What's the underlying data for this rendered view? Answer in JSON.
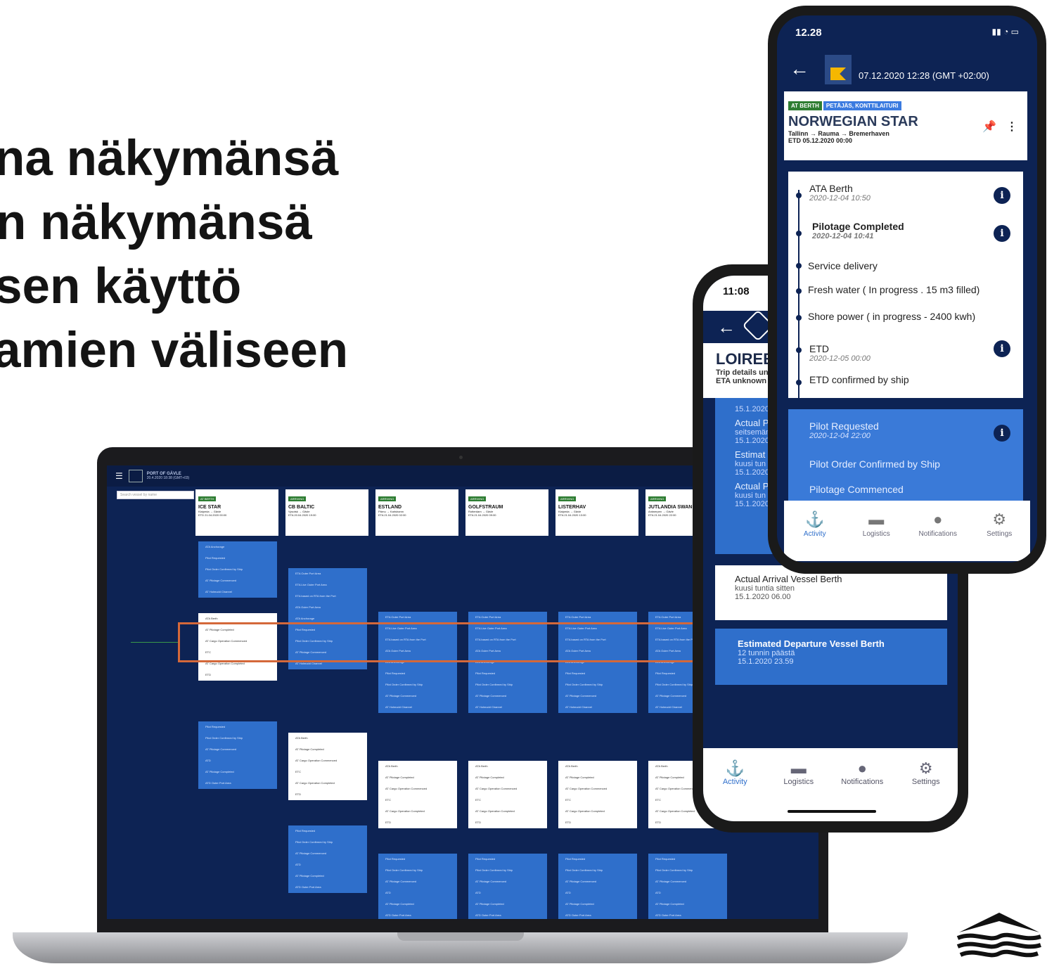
{
  "headline": {
    "line1": "na näkymänsä",
    "line2": "n näkymänsä",
    "line3": "sen käyttö",
    "line4": "amien väliseen"
  },
  "laptop": {
    "port_title": "PORT OF GÄVLE",
    "port_time": "20.4.2020 18:38 (GMT+03)",
    "search_placeholder": "Search vessel by name",
    "ships": [
      {
        "badge": "AT BERTH",
        "name": "ICE STAR",
        "route": "Klaipeda → Gävle",
        "eta": "ETD 21.04.2020 00:00"
      },
      {
        "badge": "ARRIVING",
        "name": "CB BALTIC",
        "route": "Vysotsk → Gävle",
        "eta": "ETA 20.04.2020 19:00"
      },
      {
        "badge": "ARRIVING",
        "name": "ESTLAND",
        "route": "Pärnu → Karlshamn",
        "eta": "ETA 21.04.2020 02:00"
      },
      {
        "badge": "ARRIVING",
        "name": "GOLFSTRAUM",
        "route": "Rotterdam → Gävle",
        "eta": "ETA 21.04.2020 09:00"
      },
      {
        "badge": "ARRIVING",
        "name": "LISTERHAV",
        "route": "Klaipeda → Gävle",
        "eta": "ETA 21.04.2020 13:00"
      },
      {
        "badge": "ARRIVING",
        "name": "JUTLANDIA SWAN",
        "route": "Antwerpen → Gävle",
        "eta": "ETA 21.04.2020 22:00"
      }
    ],
    "timeline_rows": [
      "ATA Anchorage",
      "Pilot Requested",
      "Pilot Order Confirmed by Ship",
      "AT Pilotage Commenced",
      "AT Holmudd Channel",
      "ATA Berth",
      "AT Pilotage Completed",
      "AT Cargo Operation Commenced",
      "ETC",
      "AT Cargo Operation Completed",
      "ETD",
      "Pilot Requested",
      "Pilot Order Confirmed by Ship",
      "AT Pilotage Commenced",
      "ATD",
      "AT Pilotage Completed",
      "ATD Outer Port Area"
    ],
    "arriving_rows": [
      "ETA Outer Port Area",
      "ETA Live Outer Port Area",
      "ETA based on RTA from the Port",
      "ATA Outer Port Area",
      "ATA Anchorage",
      "Pilot Requested",
      "Pilot Order Confirmed by Ship",
      "AT Pilotage Commenced",
      "AT Holmudd Channel"
    ]
  },
  "phone_back": {
    "time": "11:08",
    "vessel_name": "LOIREB",
    "trip_details": "Trip details un",
    "eta": "ETA unknown",
    "blue_events": [
      {
        "title": "",
        "sub": "15.1.2020"
      },
      {
        "title": "Actual P",
        "sub": "seitsemän"
      },
      {
        "title": "",
        "sub": "15.1.2020"
      },
      {
        "title": "Estimat",
        "sub": "kuusi tun"
      },
      {
        "title": "",
        "sub": "15.1.2020"
      },
      {
        "title": "Actual P",
        "sub": "kuusi tun"
      },
      {
        "title": "",
        "sub": "15.1.2020"
      }
    ],
    "card_title": "Actual Arrival Vessel Berth",
    "card_sub1": "kuusi tuntia sitten",
    "card_sub2": "15.1.2020 06.00",
    "blue_card_title": "Estimated Departure Vessel Berth",
    "blue_card_sub1": "12 tunnin päästä",
    "blue_card_sub2": "15.1.2020 23.59",
    "nav": [
      "Activity",
      "Logistics",
      "Notifications",
      "Settings"
    ]
  },
  "phone_front": {
    "time": "12.28",
    "datetime": "07.12.2020 12:28 (GMT +02:00)",
    "badge_status": "AT BERTH",
    "badge_location": "PETÄJÄS, KONTTILAITURI",
    "vessel_name": "NORWEGIAN STAR",
    "route": "Tallinn → Rauma → Bremerhaven",
    "etd": "ETD 05.12.2020 00:00",
    "events": [
      {
        "title": "ATA Berth",
        "ts": "2020-12-04 10:50"
      },
      {
        "title": "Pilotage Completed",
        "ts": "2020-12-04 10:41"
      },
      {
        "title": "Service delivery",
        "ts": ""
      },
      {
        "title": "Fresh water ( In progress . 15 m3 filled)",
        "ts": ""
      },
      {
        "title": "Shore power ( in progress - 2400 kwh)",
        "ts": ""
      },
      {
        "title": "ETD",
        "ts": "2020-12-05 00:00"
      },
      {
        "title": "ETD confirmed by ship",
        "ts": ""
      }
    ],
    "blue_events": [
      {
        "title": "Pilot Requested",
        "ts": "2020-12-04 22:00"
      },
      {
        "title": "Pilot Order Confirmed by Ship",
        "ts": ""
      },
      {
        "title": "Pilotage Commenced",
        "ts": ""
      }
    ],
    "nav": [
      "Activity",
      "Logistics",
      "Notifications",
      "Settings"
    ]
  },
  "colors": {
    "navy": "#0d2354",
    "blue": "#2f6fcb",
    "highlight": "#d4683a",
    "berth_green": "#2e7d32"
  }
}
